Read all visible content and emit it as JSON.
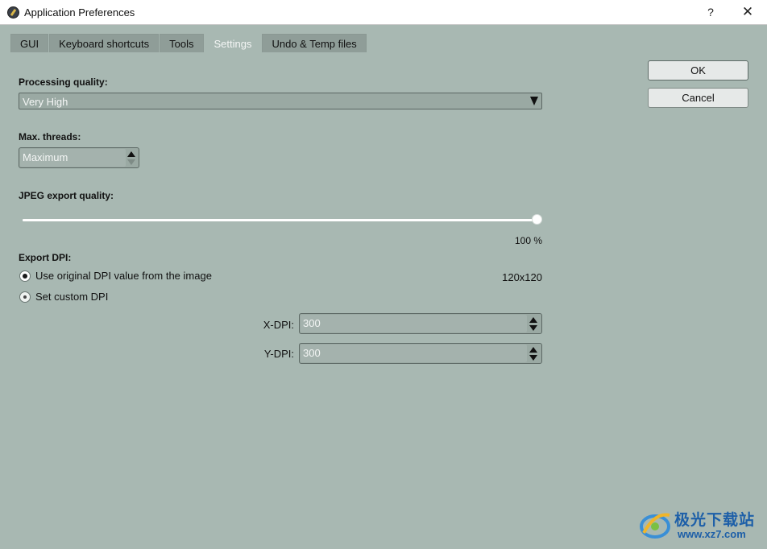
{
  "window": {
    "title": "Application Preferences",
    "help_label": "?",
    "close_label": "✕"
  },
  "tabs": [
    {
      "label": "GUI",
      "active": false
    },
    {
      "label": "Keyboard shortcuts",
      "active": false
    },
    {
      "label": "Tools",
      "active": false
    },
    {
      "label": "Settings",
      "active": true
    },
    {
      "label": "Undo & Temp files",
      "active": false
    }
  ],
  "settings": {
    "processing_quality": {
      "label": "Processing quality:",
      "value": "Very High"
    },
    "max_threads": {
      "label": "Max. threads:",
      "value": "Maximum"
    },
    "jpeg_quality": {
      "label": "JPEG export quality:",
      "value": 100,
      "value_text": "100 %"
    },
    "export_dpi": {
      "label": "Export DPI:",
      "use_original_label": "Use original DPI value from the image",
      "original_value": "120x120",
      "custom_label": "Set custom DPI",
      "x_label": "X-DPI:",
      "x_value": "300",
      "y_label": "Y-DPI:",
      "y_value": "300"
    }
  },
  "buttons": {
    "ok_label": "OK",
    "cancel_label": "Cancel"
  },
  "watermark": {
    "text_cn": "极光下载站",
    "url": "www.xz7.com"
  },
  "colors": {
    "background": "#a8b8b2",
    "tab_inactive": "#8f9d98",
    "watermark_blue": "#1d5fa8"
  }
}
